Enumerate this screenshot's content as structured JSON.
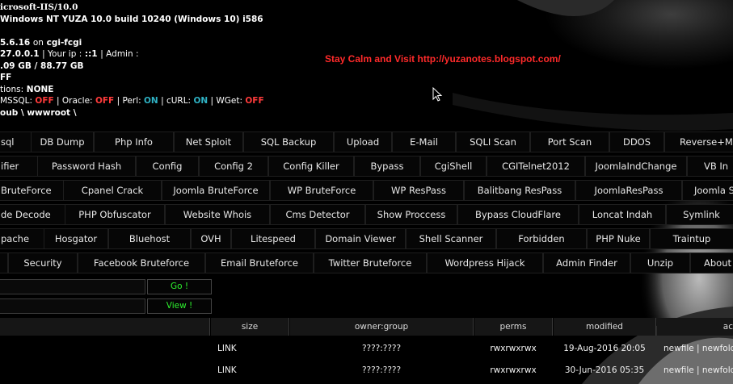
{
  "server_info": {
    "line1": "icrosoft-IIS/10.0",
    "line2": "Windows NT YUZA 10.0 build 10240 (Windows 10) i586",
    "php_version": "5.6.16",
    "php_mode_sep": "on",
    "php_mode": "cgi-fcgi",
    "server_ip": "27.0.0.1",
    "your_ip_label": "| Your ip :",
    "your_ip": "::1",
    "admin_label": "| Admin :",
    "hdd": ".09 GB / 88.77 GB",
    "safe_mode": "FF",
    "disabled_label": "tions:",
    "disabled_value": "NONE",
    "mssql_label": "MSSQL:",
    "mssql": "OFF",
    "oracle_label": "| Oracle:",
    "oracle": "OFF",
    "perl_label": "| Perl:",
    "perl": "ON",
    "curl_label": "| cURL:",
    "curl": "ON",
    "wget_label": "| WGet:",
    "wget": "OFF",
    "path": "oub \\ wwwroot \\"
  },
  "banner": "Stay Calm and Visit http://yuzanotes.blogspot.com/",
  "menu": {
    "row1": [
      "sql",
      "DB Dump",
      "Php Info",
      "Net Sploit",
      "SQL Backup",
      "Upload",
      "E-Mail",
      "SQLI Scan",
      "Port Scan",
      "DDOS",
      "Reverse+M"
    ],
    "row2": [
      "ifier",
      "Password Hash",
      "Config",
      "Config 2",
      "Config Killer",
      "Bypass",
      "CgiShell",
      "CGITelnet2012",
      "JoomlaIndChange",
      "VB In"
    ],
    "row3": [
      "BruteForce",
      "Cpanel Crack",
      "Joomla BruteForce",
      "WP BruteForce",
      "WP ResPass",
      "Balitbang ResPass",
      "JoomlaResPass",
      "Joomla S"
    ],
    "row4": [
      "de Decode",
      "PHP Obfuscator",
      "Website Whois",
      "Cms Detector",
      "Show Proccess",
      "Bypass CloudFlare",
      "Loncat Indah",
      "Symlink"
    ],
    "row5": [
      "pache",
      "Hosgator",
      "Bluehost",
      "OVH",
      "Litespeed",
      "Domain Viewer",
      "Shell Scanner",
      "Forbidden",
      "PHP Nuke",
      "Traintup"
    ],
    "row6": [
      "",
      "Security",
      "Facebook Bruteforce",
      "Email Bruteforce",
      "Twitter Bruteforce",
      "Wordpress Hijack",
      "Admin Finder",
      "Unzip",
      "About"
    ]
  },
  "forms": {
    "go_label": "Go !",
    "view_label": "View !",
    "go_value": "",
    "view_value": ""
  },
  "table": {
    "headers": [
      "",
      "size",
      "owner:group",
      "perms",
      "modified",
      "ac"
    ],
    "rows": [
      [
        "",
        "LINK",
        "????:????",
        "rwxrwxrwx",
        "19-Aug-2016 20:05",
        "newfile | newfolde"
      ],
      [
        "",
        "LINK",
        "????:????",
        "rwxrwxrwx",
        "30-Jun-2016 05:35",
        "newfile | newfolde"
      ]
    ]
  },
  "colors": {
    "off": "#ff3b3b",
    "on": "#2fb3c5",
    "banner": "#ff2a2a",
    "button_text": "#2ef22e"
  }
}
